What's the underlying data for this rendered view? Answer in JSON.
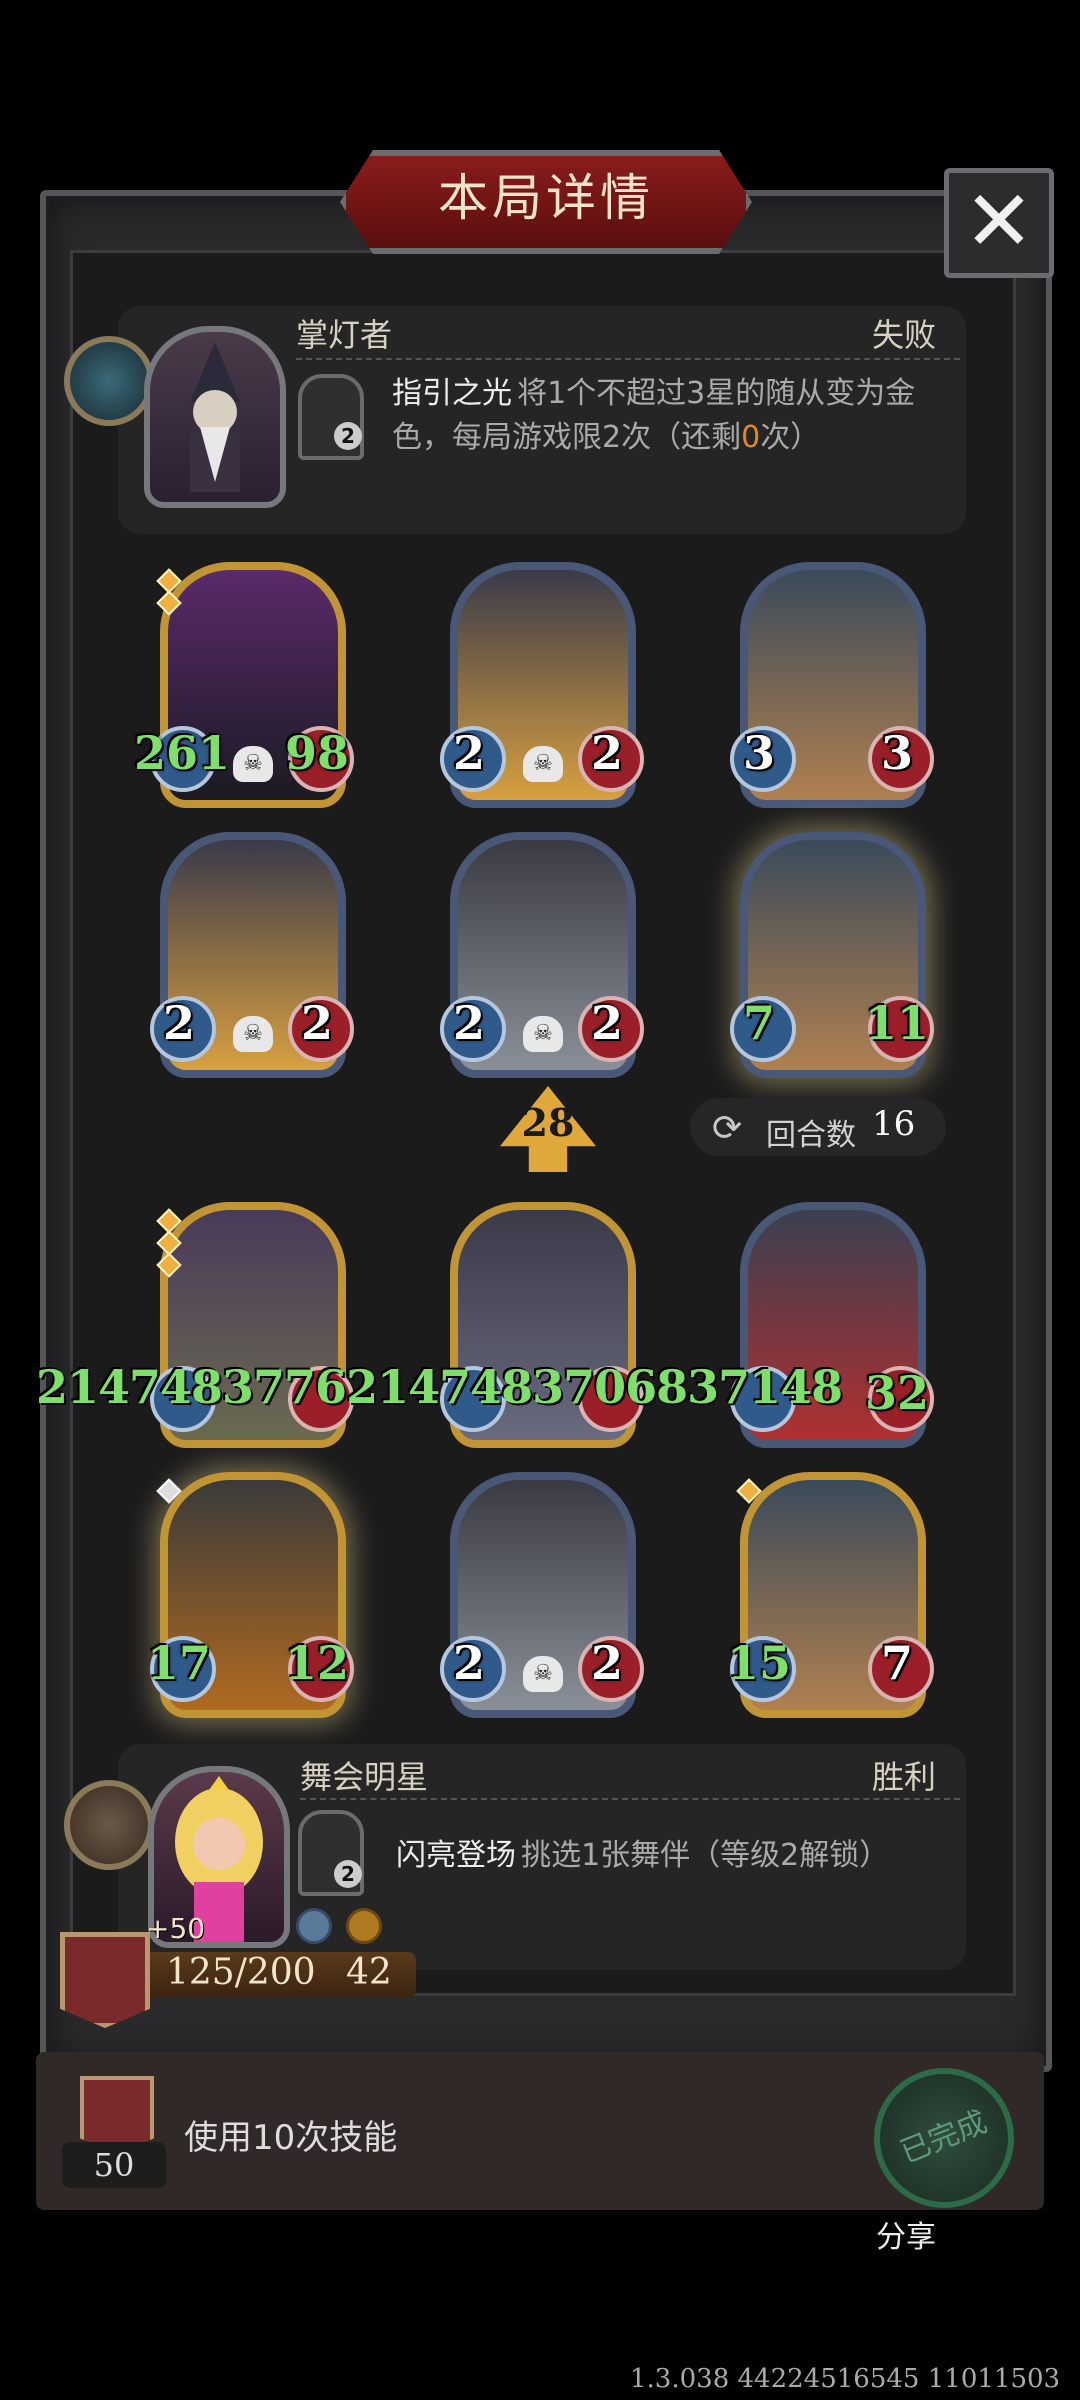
{
  "title": "本局详情",
  "close_label": "✕",
  "opponent": {
    "name": "掌灯者",
    "result": "失败",
    "skill_level": "2",
    "skill_title": "指引之光",
    "skill_desc_line1_pre": "将1个不超过3星的随从变为金",
    "skill_desc_line2_pre": "色，每局游戏限2次（还剩",
    "skill_desc_remaining": "0",
    "skill_desc_line2_post": "次）"
  },
  "opponent_board": [
    {
      "atk": "261",
      "hp": "98",
      "frame": "gold",
      "pips": 2,
      "pip_color": "gold",
      "name": "dark-knight",
      "atk_green": true,
      "hp_green": true,
      "skull": true
    },
    {
      "atk": "2",
      "hp": "2",
      "frame": "blue",
      "pips": 0,
      "name": "pinocchio",
      "skull": true
    },
    {
      "atk": "3",
      "hp": "3",
      "frame": "blue",
      "pips": 0,
      "name": "rocket-bomb",
      "skull": false
    },
    {
      "atk": "2",
      "hp": "2",
      "frame": "blue",
      "pips": 0,
      "name": "pinocchio",
      "skull": true
    },
    {
      "atk": "2",
      "hp": "2",
      "frame": "blue",
      "pips": 0,
      "name": "robot-dome",
      "skull": true
    },
    {
      "atk": "7",
      "hp": "11",
      "frame": "blue",
      "pips": 0,
      "glow": true,
      "name": "rocket-bomb",
      "atk_green": true,
      "hp_green": true,
      "skull": false
    }
  ],
  "damage": "28",
  "turns": {
    "label": "回合数",
    "value": "16"
  },
  "player_board": [
    {
      "atk": "",
      "hp": "",
      "frame": "gold",
      "pips": 3,
      "pip_color": "gold",
      "name": "stone-golem",
      "skull": false
    },
    {
      "atk": "",
      "hp": "",
      "frame": "gold",
      "pips": 0,
      "name": "chef-gremlin",
      "skull": false
    },
    {
      "atk": "",
      "hp": "32",
      "frame": "blue",
      "pips": 0,
      "name": "red-mech-dragon",
      "hp_green": true,
      "skull": false
    },
    {
      "atk": "17",
      "hp": "12",
      "frame": "gold",
      "pips": 1,
      "pip_color": "silver",
      "glow": true,
      "name": "pumpkin-cauldron",
      "atk_green": true,
      "hp_green": true,
      "skull": false
    },
    {
      "atk": "2",
      "hp": "2",
      "frame": "blue",
      "pips": 0,
      "name": "robot-dome",
      "skull": true
    },
    {
      "atk": "15",
      "hp": "7",
      "frame": "gold",
      "pips": 1,
      "pip_color": "gold",
      "name": "rocket-bomb",
      "atk_green": true,
      "skull": false
    }
  ],
  "overflow_stats": "21474837762147483706837148",
  "player": {
    "name": "舞会明星",
    "result": "胜利",
    "skill_level": "2",
    "skill_title": "闪亮登场",
    "skill_desc": "挑选1张舞伴（等级2解锁）",
    "bonus": "+50",
    "rank_progress": "125/200",
    "coins": "42"
  },
  "quest": {
    "level": "50",
    "text": "使用10次技能",
    "status": "已完成"
  },
  "share_label": "分享",
  "version": "1.3.038 44224516545 11011503",
  "colors": {
    "panel": "#2a2a2c",
    "title_red": "#8a1c1c",
    "green_stat": "#7ee06a",
    "orange": "#e58a1a"
  }
}
